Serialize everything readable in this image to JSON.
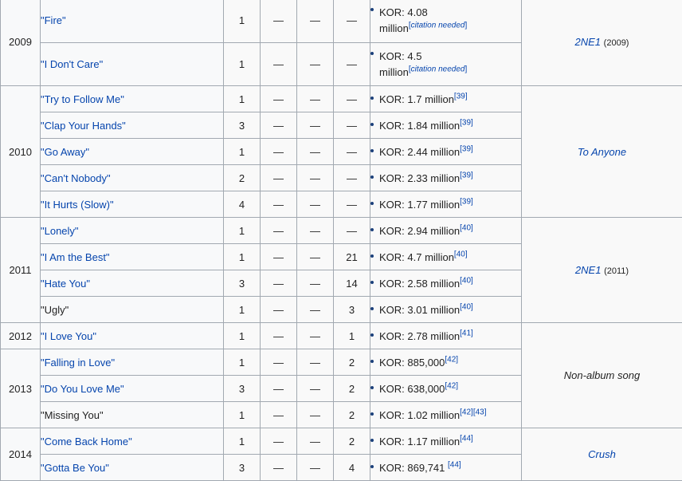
{
  "rows": [
    {
      "year": "2009",
      "title": "\"Fire\"",
      "c1": "1",
      "c2": "—",
      "c3": "—",
      "c4": "—",
      "sales_l1": "KOR: 4.08",
      "sales_l2": "million",
      "sup": "citation needed"
    },
    {
      "title": "\"I Don't Care\"",
      "c1": "1",
      "c2": "—",
      "c3": "—",
      "c4": "—",
      "sales_l1": "KOR: 4.5",
      "sales_l2": "million",
      "sup": "citation needed"
    },
    {
      "year": "2010",
      "title": "\"Try to Follow Me\"",
      "c1": "1",
      "c2": "—",
      "c3": "—",
      "c4": "—",
      "sales": "KOR: 1.7 million",
      "sup": "[39]"
    },
    {
      "title": "\"Clap Your Hands\"",
      "c1": "3",
      "c2": "—",
      "c3": "—",
      "c4": "—",
      "sales": "KOR: 1.84 million",
      "sup": "[39]"
    },
    {
      "title": "\"Go Away\"",
      "c1": "1",
      "c2": "—",
      "c3": "—",
      "c4": "—",
      "sales": "KOR: 2.44 million",
      "sup": "[39]"
    },
    {
      "title": "\"Can't Nobody\"",
      "c1": "2",
      "c2": "—",
      "c3": "—",
      "c4": "—",
      "sales": "KOR: 2.33 million",
      "sup": "[39]"
    },
    {
      "title": "\"It Hurts (Slow)\"",
      "c1": "4",
      "c2": "—",
      "c3": "—",
      "c4": "—",
      "sales": "KOR: 1.77 million",
      "sup": "[39]"
    },
    {
      "year": "2011",
      "title": "\"Lonely\"",
      "c1": "1",
      "c2": "—",
      "c3": "—",
      "c4": "—",
      "sales": "KOR: 2.94 million",
      "sup": "[40]"
    },
    {
      "title": "\"I Am the Best\"",
      "c1": "1",
      "c2": "—",
      "c3": "—",
      "c4": "21",
      "sales": "KOR: 4.7 million",
      "sup": "[40]"
    },
    {
      "title": "\"Hate You\"",
      "c1": "3",
      "c2": "—",
      "c3": "—",
      "c4": "14",
      "sales": "KOR: 2.58 million",
      "sup": "[40]"
    },
    {
      "title": "\"Ugly\"",
      "c1": "1",
      "c2": "—",
      "c3": "—",
      "c4": "3",
      "sales": "KOR: 3.01 million",
      "sup": "[40]"
    },
    {
      "year": "2012",
      "title": "\"I Love You\"",
      "c1": "1",
      "c2": "—",
      "c3": "—",
      "c4": "1",
      "sales": "KOR: 2.78 million",
      "sup": "[41]"
    },
    {
      "year": "2013",
      "title": "\"Falling in Love\"",
      "c1": "1",
      "c2": "—",
      "c3": "—",
      "c4": "2",
      "sales": "KOR: 885,000",
      "sup": "[42]"
    },
    {
      "title": "\"Do You Love Me\"",
      "c1": "3",
      "c2": "—",
      "c3": "—",
      "c4": "2",
      "sales": "KOR: 638,000",
      "sup": "[42]"
    },
    {
      "title": "\"Missing You\"",
      "c1": "1",
      "c2": "—",
      "c3": "—",
      "c4": "2",
      "sales": "KOR: 1.02 million",
      "sup": "[42][43]"
    },
    {
      "year": "2014",
      "title": "\"Come Back Home\"",
      "c1": "1",
      "c2": "—",
      "c3": "—",
      "c4": "2",
      "sales": "KOR: 1.17 million",
      "sup": "[44]"
    },
    {
      "title": "\"Gotta Be You\"",
      "c1": "3",
      "c2": "—",
      "c3": "—",
      "c4": "4",
      "sales": "KOR: 869,741 ",
      "sup": "[44]"
    }
  ],
  "albums": {
    "a2009": {
      "name": "2NE1",
      "year": "(2009)"
    },
    "a2010": {
      "name": "To Anyone"
    },
    "a2011": {
      "name": "2NE1",
      "year": "(2011)"
    },
    "a2013": {
      "name": "Non-album song"
    },
    "a2014": {
      "name": "Crush"
    }
  }
}
